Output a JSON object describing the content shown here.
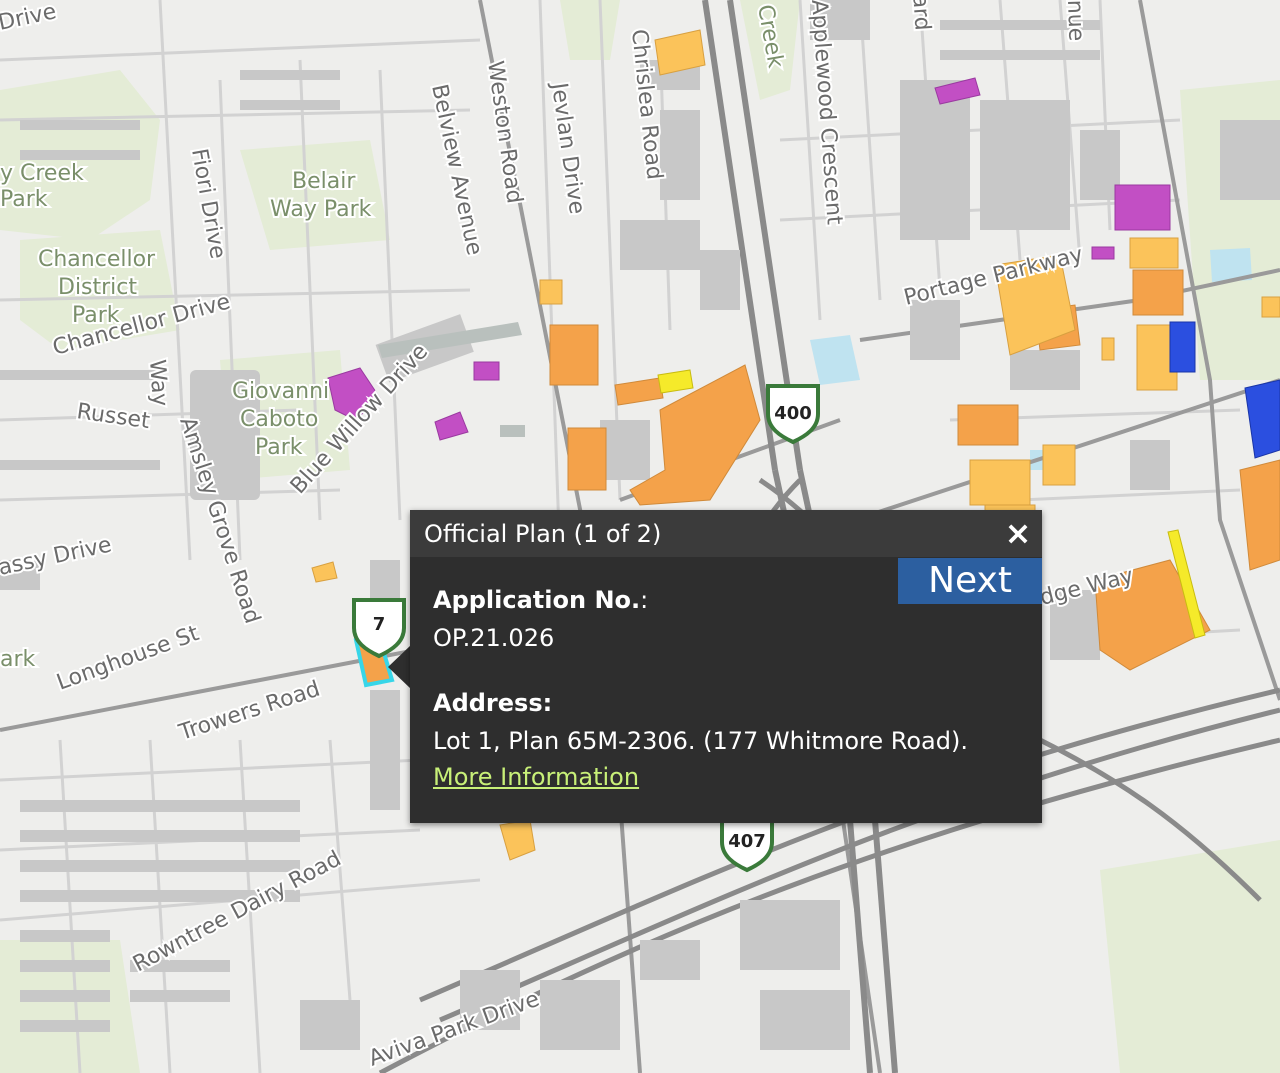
{
  "popup": {
    "title": "Official Plan (1 of 2)",
    "close_icon": "×",
    "next_label": "Next",
    "application_label": "Application No.",
    "application_colon": ":",
    "application_value": "OP.21.026",
    "address_label": "Address:",
    "address_value": "Lot 1, Plan 65M-2306. (177 Whitmore Road).",
    "more_info_label": "More Information"
  },
  "map": {
    "roads": {
      "weston": "Weston Road",
      "jevlan": "Jevlan Drive",
      "chrislea": "Chrislea Road",
      "applewood": "Applewood Crescent",
      "boulevard": "Boulevard",
      "avenue_top": "nue",
      "belview": "Belview Avenue",
      "fiori": "Fiori Drive",
      "chancellor": "Chancellor Drive",
      "russet": "Russet",
      "amsley": "Amsley Grove Road",
      "way": "Way",
      "blue_willow": "Blue Willow Drive",
      "embassy": "assy Drive",
      "longhouse": "Longhouse St",
      "trowers": "Trowers Road",
      "rowntree": "Rowntree Dairy Road",
      "aviva": "Aviva Park Drive",
      "portage": "Portage Parkway",
      "edge_way": "dge Way",
      "drive_top": "Drive"
    },
    "parks": {
      "creek_park_1": "y Creek",
      "creek_park_2": "Park",
      "belair_1": "Belair",
      "belair_2": "Way Park",
      "chancellor_1": "Chancellor",
      "chancellor_2": "District",
      "chancellor_3": "Park",
      "giovanni_1": "Giovanni",
      "giovanni_2": "Caboto",
      "giovanni_3": "Park",
      "creek_top": "Creek",
      "ark_left": "ark"
    },
    "shields": {
      "hwy400": "400",
      "hwy407": "407",
      "hwy7": "7"
    },
    "colors": {
      "background": "#eeeeec",
      "building": "#c8c8c8",
      "orange": "#f4a24a",
      "light_orange": "#fbc35a",
      "yellow": "#f5ea2a",
      "magenta": "#c24fc4",
      "blue": "#2b4fe0",
      "selection": "#37d6e8",
      "park": "#e4ecd6",
      "water": "#bfe3f0"
    }
  }
}
